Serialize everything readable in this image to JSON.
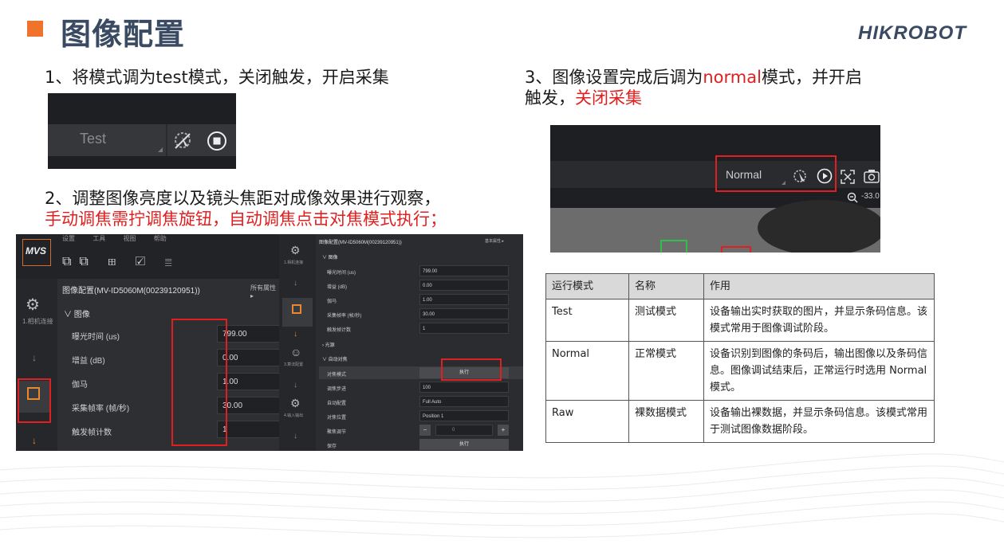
{
  "slide": {
    "title": "图像配置",
    "logo": "HIKROBOT",
    "accent_color": "#f0722c",
    "title_color": "#3a4a63",
    "highlight_color": "#e02020"
  },
  "steps": {
    "step1": "1、将模式调为test模式，关闭触发，开启采集",
    "step2_line1": "2、调整图像亮度以及镜头焦距对成像效果进行观察，",
    "step2_line2": "手动调焦需拧调焦旋钮，自动调焦点击对焦模式执行；",
    "step3_prefix": "3、图像设置完成后调为",
    "step3_mode": "normal",
    "step3_mid": "模式，并开启",
    "step3_line2a": "触发，",
    "step3_line2b": "关闭采集"
  },
  "shot1": {
    "mode_value": "Test",
    "icons": [
      "trigger-off-icon",
      "stop-icon"
    ]
  },
  "shot2": {
    "logo": "MVS",
    "menu": [
      "设置",
      "工具",
      "视图",
      "帮助"
    ],
    "side_label": "1.相机连接",
    "panel_title": "图像配置(MV-ID5060M(00239120951))",
    "all_props": "所有属性 ▸",
    "section": "图像",
    "rows": [
      {
        "label": "曝光时间 (us)",
        "value": "799.00"
      },
      {
        "label": "增益 (dB)",
        "value": "0.00"
      },
      {
        "label": "伽马",
        "value": "1.00"
      },
      {
        "label": "采集帧率 (帧/秒)",
        "value": "30.00"
      },
      {
        "label": "触发帧计数",
        "value": "1"
      }
    ],
    "right": {
      "title": "图像配置(MV-ID5060M(00239120951))",
      "basic_props": "基本属性 ▸",
      "side": [
        "1.相机连接",
        "3.算法配置",
        "4.输入输出"
      ],
      "section_image": "图像",
      "rows": [
        {
          "label": "曝光时间 (us)",
          "value": "799.00"
        },
        {
          "label": "增益 (dB)",
          "value": "0.00"
        },
        {
          "label": "伽马",
          "value": "1.00"
        },
        {
          "label": "采集帧率 (帧/秒)",
          "value": "30.00"
        },
        {
          "label": "触发帧计数",
          "value": "1"
        }
      ],
      "section_light": "光源",
      "section_af": "自动对焦",
      "af_rows": [
        {
          "label": "对焦模式",
          "value": "执行",
          "kind": "button"
        },
        {
          "label": "调焦步进",
          "value": "100",
          "kind": "field"
        },
        {
          "label": "自动配置",
          "value": "Full Auto",
          "kind": "field"
        },
        {
          "label": "对焦位置",
          "value": "Position 1",
          "kind": "field"
        },
        {
          "label": "聚焦调节",
          "value": "0",
          "kind": "stepper"
        },
        {
          "label": "保存",
          "value": "执行",
          "kind": "button"
        }
      ]
    }
  },
  "shot3": {
    "mode_value": "Normal",
    "zoom": "-33.0"
  },
  "table": {
    "headers": [
      "运行模式",
      "名称",
      "作用"
    ],
    "rows": [
      {
        "mode": "Test",
        "name": "测试模式",
        "desc": "设备输出实时获取的图片，并显示条码信息。该模式常用于图像调试阶段。"
      },
      {
        "mode": "Normal",
        "name": "正常模式",
        "desc": "设备识别到图像的条码后，输出图像以及条码信息。图像调试结束后，正常运行时选用 Normal 模式。"
      },
      {
        "mode": "Raw",
        "name": "裸数据模式",
        "desc": "设备输出裸数据，并显示条码信息。该模式常用于测试图像数据阶段。"
      }
    ]
  }
}
